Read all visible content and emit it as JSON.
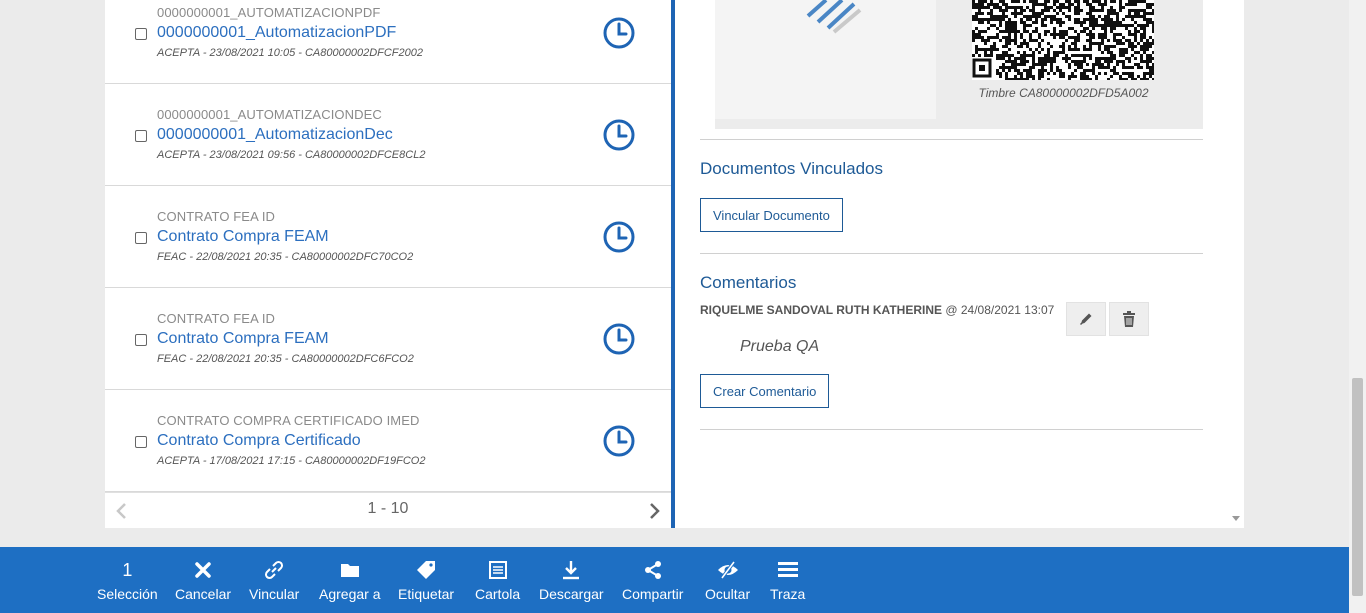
{
  "documents": [
    {
      "type": "0000000001_AUTOMATIZACIONPDF",
      "title": "0000000001_AutomatizacionPDF",
      "meta": "ACEPTA - 23/08/2021 10:05 - CA80000002DFCF2002"
    },
    {
      "type": "0000000001_AUTOMATIZACIONDEC",
      "title": "0000000001_AutomatizacionDec",
      "meta": "ACEPTA - 23/08/2021 09:56 - CA80000002DFCE8CL2"
    },
    {
      "type": "CONTRATO FEA ID",
      "title": "Contrato Compra FEAM",
      "meta": "FEAC - 22/08/2021 20:35 - CA80000002DFC70CO2"
    },
    {
      "type": "CONTRATO FEA ID",
      "title": "Contrato Compra FEAM",
      "meta": "FEAC - 22/08/2021 20:35 - CA80000002DFC6FCO2"
    },
    {
      "type": "CONTRATO COMPRA CERTIFICADO IMED",
      "title": "Contrato Compra Certificado",
      "meta": "ACEPTA - 17/08/2021 17:15 - CA80000002DF19FCO2"
    }
  ],
  "pagination": {
    "label": "1 - 10"
  },
  "detail": {
    "timbre": "Timbre CA80000002DFD5A002",
    "linked_title": "Documentos Vinculados",
    "link_button": "Vincular Documento",
    "comments_title": "Comentarios",
    "comment": {
      "author": "RIQUELME SANDOVAL RUTH KATHERINE",
      "when": "@ 24/08/2021 13:07",
      "text": "Prueba QA"
    },
    "create_comment_button": "Crear Comentario"
  },
  "toolbar": {
    "count": "1",
    "items": [
      {
        "label": "Selección",
        "icon": "count"
      },
      {
        "label": "Cancelar",
        "icon": "close-icon"
      },
      {
        "label": "Vincular",
        "icon": "link-icon"
      },
      {
        "label": "Agregar a",
        "icon": "folder-icon"
      },
      {
        "label": "Etiquetar",
        "icon": "tag-icon"
      },
      {
        "label": "Cartola",
        "icon": "list-sheet-icon"
      },
      {
        "label": "Descargar",
        "icon": "download-icon"
      },
      {
        "label": "Compartir",
        "icon": "share-icon"
      },
      {
        "label": "Ocultar",
        "icon": "eye-slash-icon"
      },
      {
        "label": "Traza",
        "icon": "trace-list-icon"
      }
    ]
  },
  "colors": {
    "accent": "#1e6fc3",
    "link": "#2c6fbf",
    "heading": "#1e5a96"
  }
}
